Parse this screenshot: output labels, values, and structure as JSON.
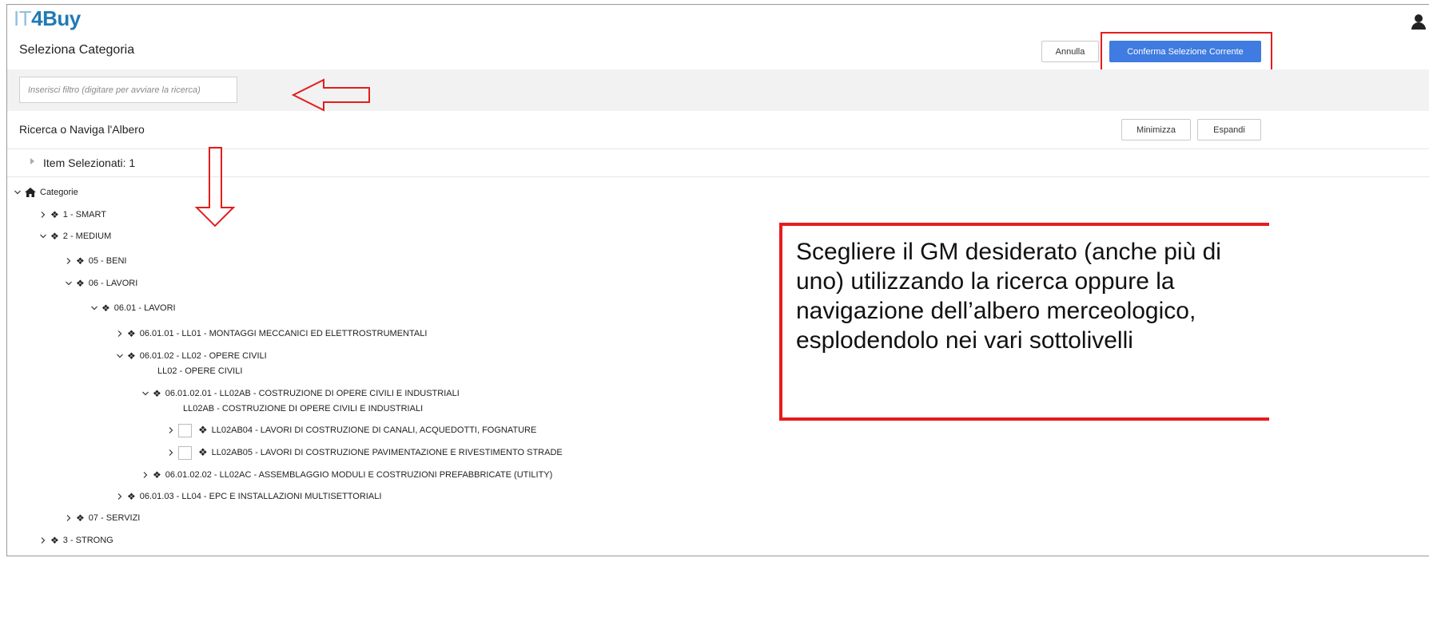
{
  "app": {
    "logo_part1": "IT",
    "logo_part2": "4Buy"
  },
  "header": {
    "title": "Seleziona Categoria",
    "cancel_label": "Annulla",
    "confirm_label": "Conferma Selezione Corrente"
  },
  "filter": {
    "placeholder": "Inserisci filtro (digitare per avviare la ricerca)"
  },
  "browse": {
    "title": "Ricerca o Naviga l'Albero",
    "minimize_label": "Minimizza",
    "expand_label": "Espandi",
    "selected_label": "Item Selezionati: 1"
  },
  "tree": {
    "root": "Categorie",
    "n1": "1 - SMART",
    "n2": "2 - MEDIUM",
    "n2_1": "05 - BENI",
    "n2_2": "06 - LAVORI",
    "n2_2_1": "06.01 - LAVORI",
    "n2_2_1_1": "06.01.01 - LL01 - MONTAGGI MECCANICI ED ELETTROSTRUMENTALI",
    "n2_2_1_2": "06.01.02 - LL02 - OPERE CIVILI",
    "n2_2_1_2_sub": "LL02 - OPERE CIVILI",
    "n2_2_1_2_1": "06.01.02.01 - LL02AB - COSTRUZIONE DI OPERE CIVILI E INDUSTRIALI",
    "n2_2_1_2_1_sub": "LL02AB - COSTRUZIONE DI OPERE CIVILI E INDUSTRIALI",
    "leaf1": "LL02AB04 - LAVORI DI COSTRUZIONE DI CANALI, ACQUEDOTTI, FOGNATURE",
    "leaf2": "LL02AB05 - LAVORI DI COSTRUZIONE PAVIMENTAZIONE E RIVESTIMENTO STRADE",
    "n2_2_1_2_2": "06.01.02.02 - LL02AC - ASSEMBLAGGIO MODULI E COSTRUZIONI PREFABBRICATE (UTILITY)",
    "n2_2_1_3": "06.01.03 - LL04 - EPC E INSTALLAZIONI MULTISETTORIALI",
    "n2_3": "07 - SERVIZI",
    "n3": "3 - STRONG"
  },
  "callout": {
    "text": "Scegliere il GM desiderato (anche più di uno) utilizzando la ricerca oppure la navigazione dell’albero merceologico, esplodendolo nei vari sottolivelli"
  },
  "colors": {
    "primary": "#3f7be0",
    "annotation": "#e41d1d",
    "logo_light": "#8fc1df",
    "logo_dark": "#1f7ab5"
  }
}
